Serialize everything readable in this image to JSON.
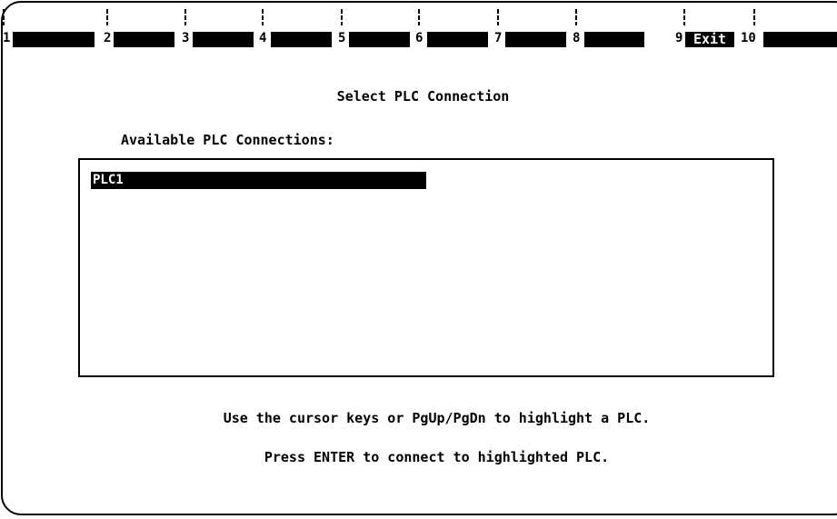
{
  "function_keys": [
    {
      "num": "1",
      "label": ""
    },
    {
      "num": "2",
      "label": ""
    },
    {
      "num": "3",
      "label": ""
    },
    {
      "num": "4",
      "label": ""
    },
    {
      "num": "5",
      "label": ""
    },
    {
      "num": "6",
      "label": ""
    },
    {
      "num": "7",
      "label": ""
    },
    {
      "num": "8",
      "label": ""
    },
    {
      "num": "9",
      "label": "Exit"
    },
    {
      "num": "10",
      "label": ""
    }
  ],
  "dialog": {
    "title": "Select PLC Connection",
    "list_label": "Available PLC Connections:",
    "connections": [
      "PLC1"
    ],
    "selected_index": 0
  },
  "instructions": {
    "line1": "Use the cursor keys or PgUp/PgDn to highlight a PLC.",
    "line2": "Press ENTER to connect to highlighted PLC."
  },
  "colors": {
    "foreground": "#000000",
    "background": "#ffffff",
    "highlight_bg": "#000000",
    "highlight_fg": "#ffffff"
  }
}
